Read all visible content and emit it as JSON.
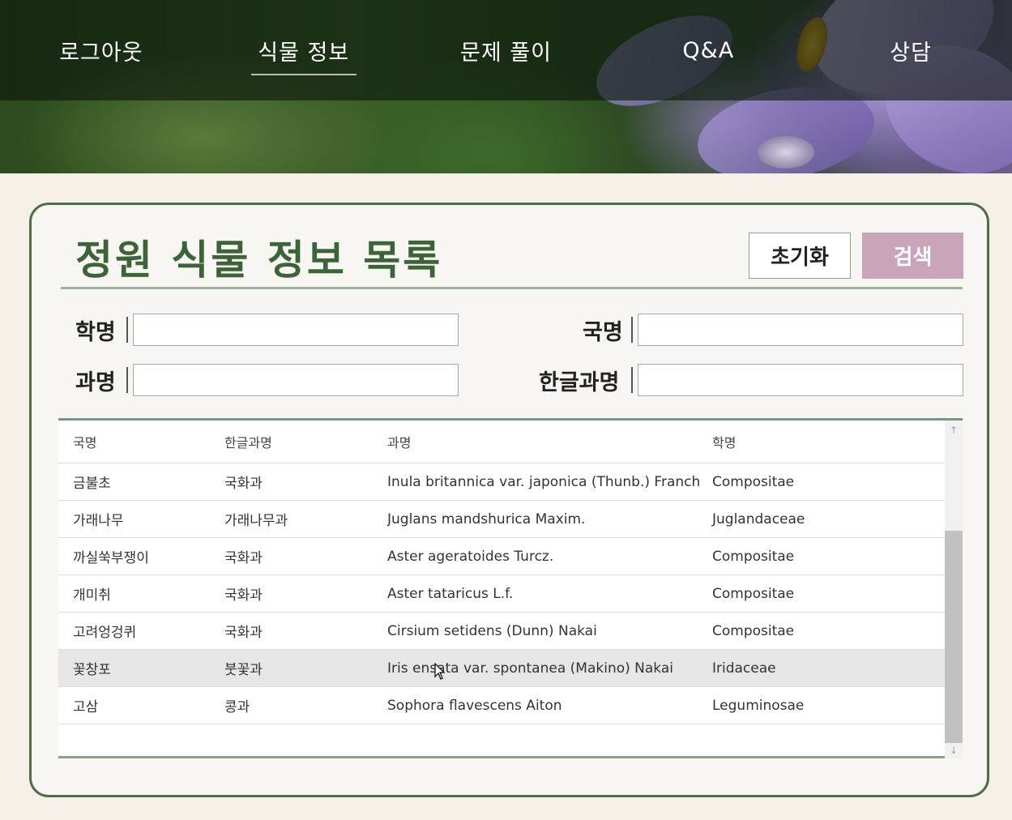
{
  "nav": {
    "items": [
      {
        "label": "로그아웃"
      },
      {
        "label": "식물 정보",
        "active": true
      },
      {
        "label": "문제 풀이"
      },
      {
        "label": "Q&A"
      },
      {
        "label": "상담"
      }
    ]
  },
  "page": {
    "title": "정원 식물 정보 목록",
    "reset_label": "초기화",
    "search_label": "검색"
  },
  "filters": {
    "scientific_name": {
      "label": "학명",
      "value": ""
    },
    "korean_name": {
      "label": "국명",
      "value": ""
    },
    "family_name": {
      "label": "과명",
      "value": ""
    },
    "korean_family_name": {
      "label": "한글과명",
      "value": ""
    }
  },
  "table": {
    "columns": [
      "국명",
      "한글과명",
      "과명",
      "학명"
    ],
    "rows": [
      [
        "금불초",
        "국화과",
        "Inula britannica var. japonica (Thunb.) Franch. & Sav.",
        "Compositae"
      ],
      [
        "가래나무",
        "가래나무과",
        "Juglans mandshurica Maxim.",
        "Juglandaceae"
      ],
      [
        "까실쑥부쟁이",
        "국화과",
        "Aster ageratoides Turcz.",
        "Compositae"
      ],
      [
        "개미취",
        "국화과",
        "Aster tataricus L.f.",
        "Compositae"
      ],
      [
        "고려엉겅퀴",
        "국화과",
        "Cirsium setidens (Dunn) Nakai",
        "Compositae"
      ],
      [
        "꽃창포",
        "붓꽃과",
        "Iris ensata var. spontanea (Makino) Nakai",
        "Iridaceae"
      ],
      [
        "고삼",
        "콩과",
        "Sophora flavescens Aiton",
        "Leguminosae"
      ]
    ],
    "highlighted_row": 5
  },
  "colors": {
    "accent_green": "#3d6438",
    "search_button": "#c8a5b8",
    "background": "#f5efe7"
  },
  "icons": {
    "scroll_up": "arrow-up-icon",
    "scroll_down": "arrow-down-icon",
    "cursor": "mouse-pointer-icon"
  }
}
